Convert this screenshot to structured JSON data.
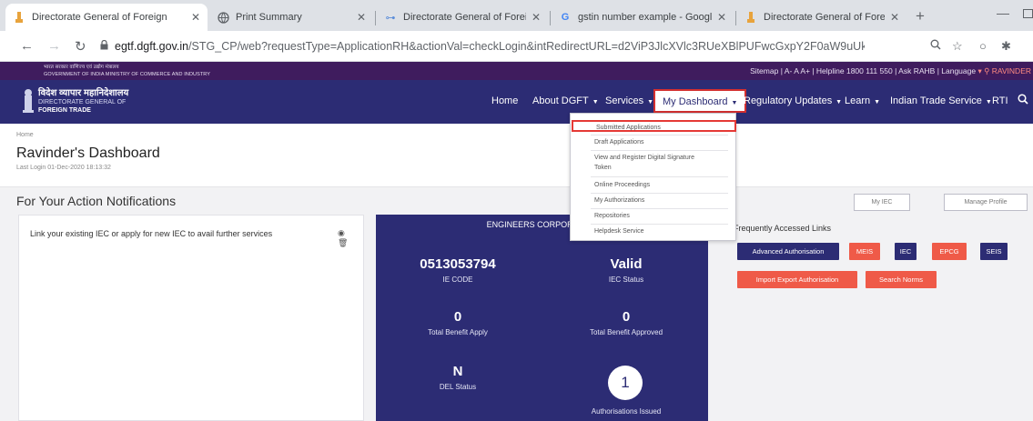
{
  "browser": {
    "tabs": [
      {
        "title": "Directorate General of Foreign",
        "close": "✕",
        "active": true
      },
      {
        "title": "Print Summary",
        "close": "✕",
        "active": false
      },
      {
        "title": "Directorate General of Foreign",
        "close": "✕",
        "active": false
      },
      {
        "title": "gstin number example - Googl",
        "close": "✕",
        "active": false
      },
      {
        "title": "Directorate General of Foreign",
        "close": "✕",
        "active": false
      }
    ],
    "new_tab": "+",
    "url_host": "egtf.dgft.gov.in",
    "url_path": "/STG_CP/web?requestType=ApplicationRH&actionVal=checkLogin&intRedirectURL=d2ViP3JlcXVlc3RUeXBlPUFwcGxpY2F0aW9uUkgmYWN0aW9u..."
  },
  "gov_bar": {
    "line1": "भारत सरकार   वाणिज्य एवं उद्योग मंत्रालय",
    "line2": "GOVERNMENT OF INDIA   MINISTRY OF COMMERCE AND INDUSTRY",
    "sitemap": "Sitemap",
    "font_small": "A-",
    "font_normal": "A",
    "font_large": "A+",
    "helpline": "Helpline 1800 111 550",
    "ask": "Ask RAHB",
    "language": "Language",
    "user": "RAVINDER"
  },
  "brand": {
    "hindi": "विदेश व्यापार महानिदेशालय",
    "line1": "DIRECTORATE GENERAL OF",
    "line2": "FOREIGN TRADE"
  },
  "nav": {
    "home": "Home",
    "about": "About DGFT",
    "services": "Services",
    "dashboard": "My Dashboard",
    "regulatory": "Regulatory Updates",
    "learn": "Learn",
    "its": "Indian Trade Service",
    "rti": "RTI"
  },
  "dropdown": {
    "items": [
      "Submitted Applications",
      "Draft Applications",
      "View and Register Digital Signature",
      "Token",
      "Online Proceedings",
      "My Authorizations",
      "Repositories",
      "Helpdesk Service"
    ]
  },
  "page": {
    "breadcrumb": "Home",
    "title": "Ravinder's Dashboard",
    "last_login": "Last Login 01-Dec-2020 18:13:32"
  },
  "action": {
    "title": "For Your Action Notifications",
    "my_iec": "My IEC",
    "manage_profile": "Manage Profile"
  },
  "notification": {
    "text": "Link your existing IEC or apply for new IEC to avail further services",
    "icons": "◉ 🗑"
  },
  "iec_card": {
    "company": "ENGINEERS CORPORATION",
    "ie_code": "0513053794",
    "ie_code_label": "IE CODE",
    "iec_status": "Valid",
    "iec_status_label": "IEC Status",
    "total_apply": "0",
    "total_apply_label": "Total Benefit Apply",
    "total_approved": "0",
    "total_approved_label": "Total Benefit Approved",
    "del_status": "N",
    "del_status_label": "DEL Status",
    "auth_issued": "1",
    "auth_issued_label": "Authorisations Issued"
  },
  "links": {
    "title": "Frequently Accessed Links",
    "advanced_auth": "Advanced Authorisation",
    "meis": "MEIS",
    "iec": "IEC",
    "epcg": "EPCG",
    "seis": "SEIS",
    "import_export": "Import Export Authorisation",
    "search_norms": "Search Norms"
  },
  "colors": {
    "navy": "#2c2c74",
    "gov_bar": "#3f1c5e",
    "accent_red": "#ef5a48",
    "highlight": "#e53935"
  }
}
